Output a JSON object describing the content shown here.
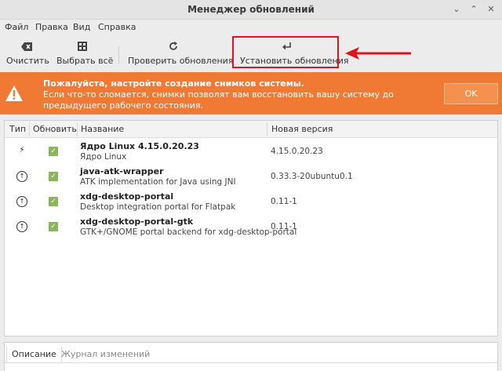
{
  "window": {
    "title": "Менеджер обновлений",
    "minimize_glyph": "⌄",
    "restore_glyph": "⌃",
    "close_glyph": "✕"
  },
  "menu": [
    "Файл",
    "Правка",
    "Вид",
    "Справка"
  ],
  "toolbar": {
    "clear": {
      "label": "Очистить",
      "icon": "clear-icon"
    },
    "select_all": {
      "label": "Выбрать всё",
      "icon": "select-all-icon"
    },
    "refresh": {
      "label": "Проверить обновления",
      "icon": "refresh-icon"
    },
    "install": {
      "label": "Установить обновления",
      "icon": "install-icon"
    }
  },
  "banner": {
    "title": "Пожалуйста, настройте создание снимков системы.",
    "body": "Если что-то сломается, снимки позволят вам восстановить вашу систему до предыдущего рабочего состояния.",
    "ok": "OK",
    "color": "#f07a34"
  },
  "table": {
    "headers": {
      "type": "Тип",
      "update": "Обновить",
      "name": "Название",
      "version": "Новая версия"
    },
    "rows": [
      {
        "type_icon": "kernel-icon",
        "type_glyph": "⚡",
        "checked": true,
        "name": "Ядро Linux 4.15.0.20.23",
        "desc": "Ядро Linux",
        "version": "4.15.0.20.23"
      },
      {
        "type_icon": "upgrade-icon",
        "type_glyph": "↑",
        "checked": true,
        "name": "java-atk-wrapper",
        "desc": "ATK implementation for Java using JNI",
        "version": "0.33.3-20ubuntu0.1"
      },
      {
        "type_icon": "upgrade-icon",
        "type_glyph": "↑",
        "checked": true,
        "name": "xdg-desktop-portal",
        "desc": "Desktop integration portal for Flatpak",
        "version": "0.11-1"
      },
      {
        "type_icon": "upgrade-icon",
        "type_glyph": "↑",
        "checked": true,
        "name": "xdg-desktop-portal-gtk",
        "desc": "GTK+/GNOME portal backend for xdg-desktop-portal",
        "version": "0.11-1"
      }
    ]
  },
  "tabs": {
    "description": "Описание",
    "changelog": "Журнал изменений"
  }
}
